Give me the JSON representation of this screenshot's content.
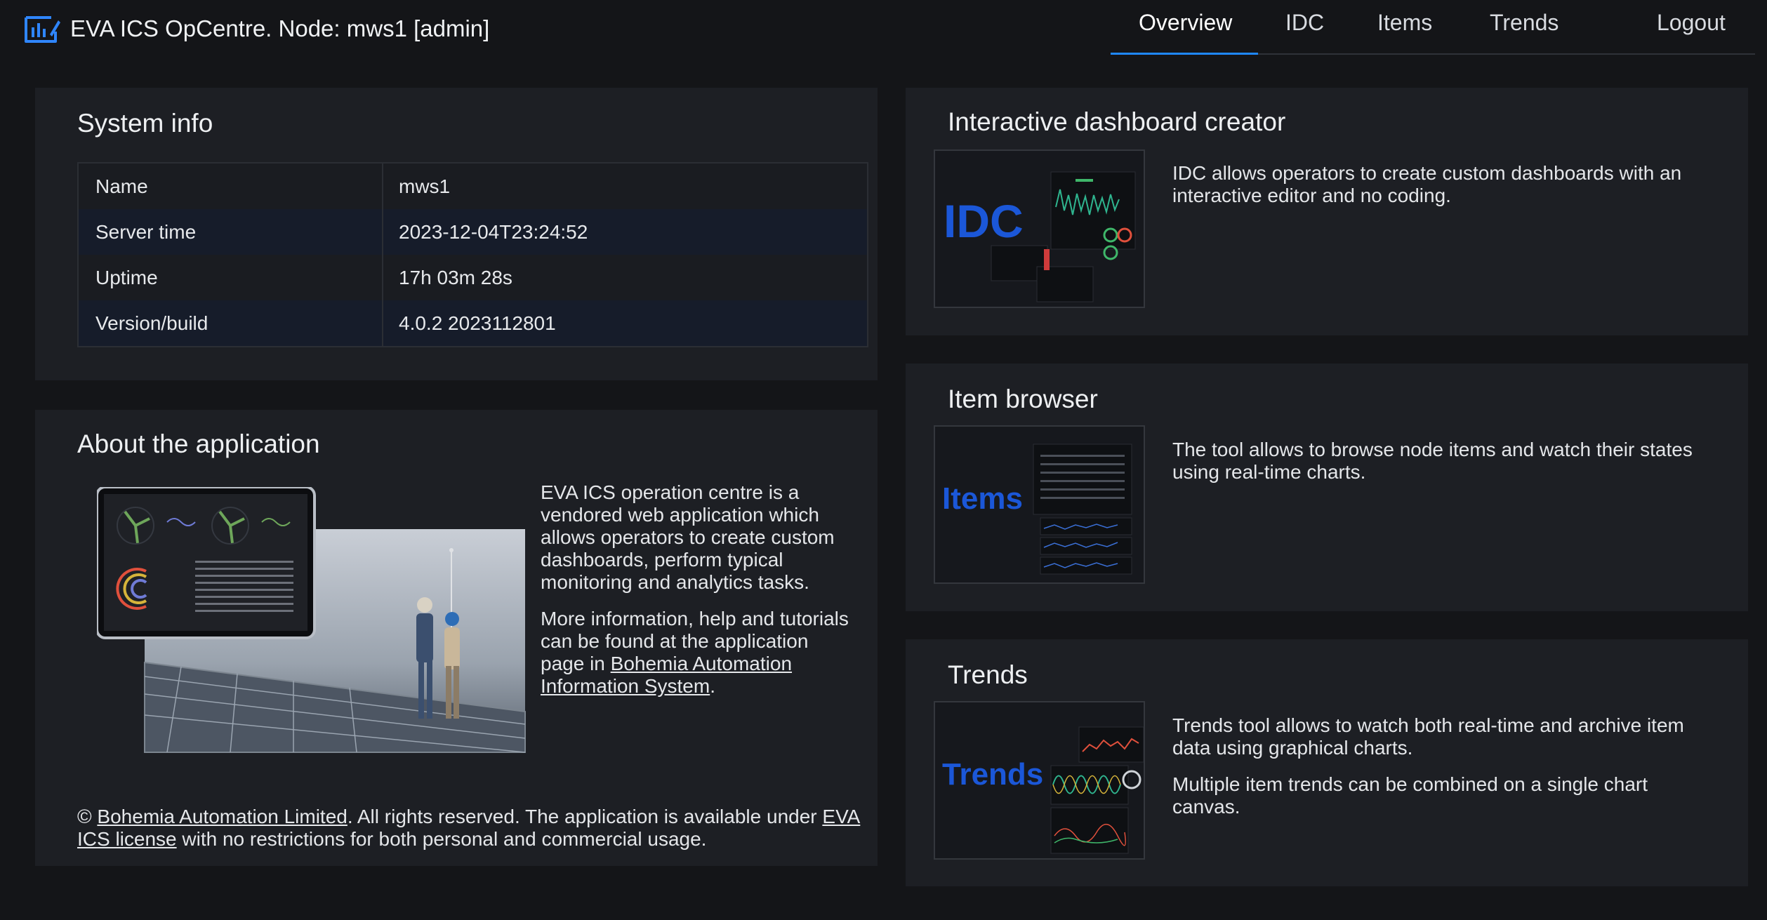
{
  "header": {
    "title": "EVA ICS OpCentre. Node: mws1 [admin]",
    "nav": {
      "overview": "Overview",
      "idc": "IDC",
      "items": "Items",
      "trends": "Trends",
      "logout": "Logout"
    },
    "active_tab": "Overview"
  },
  "system_info": {
    "title": "System info",
    "rows": [
      {
        "key": "Name",
        "value": "mws1"
      },
      {
        "key": "Server time",
        "value": "2023-12-04T23:24:52"
      },
      {
        "key": "Uptime",
        "value": "17h 03m 28s"
      },
      {
        "key": "Version/build",
        "value": "4.0.2 2023112801"
      }
    ]
  },
  "about": {
    "title": "About the application",
    "p1": "EVA ICS operation centre is a vendored web application which allows operators to create custom dashboards, perform typical monitoring and analytics tasks.",
    "p2_prefix": "More information, help and tutorials can be found at the application page in ",
    "p2_link": "Bohemia Automation Information System",
    "p2_suffix": ".",
    "footer_prefix": "© ",
    "footer_link1": "Bohemia Automation Limited",
    "footer_mid": ". All rights reserved. The application is available under ",
    "footer_link2": "EVA ICS license",
    "footer_suffix": " with no restrictions for both personal and commercial usage."
  },
  "idc": {
    "title": "Interactive dashboard creator",
    "thumb_word": "IDC",
    "desc": "IDC allows operators to create custom dashboards with an interactive editor and no coding."
  },
  "item_browser": {
    "title": "Item browser",
    "thumb_word": "Items",
    "desc": "The tool allows to browse node items and watch their states using real-time charts."
  },
  "trends": {
    "title": "Trends",
    "thumb_word": "Trends",
    "desc1": "Trends tool allows to watch both real-time and archive item data using graphical charts.",
    "desc2": "Multiple item trends can be combined on a single chart canvas."
  },
  "colors": {
    "background": "#141518",
    "panel": "#1d1f24",
    "accent": "#1f87ff",
    "thumb_word": "#1b57d8"
  }
}
